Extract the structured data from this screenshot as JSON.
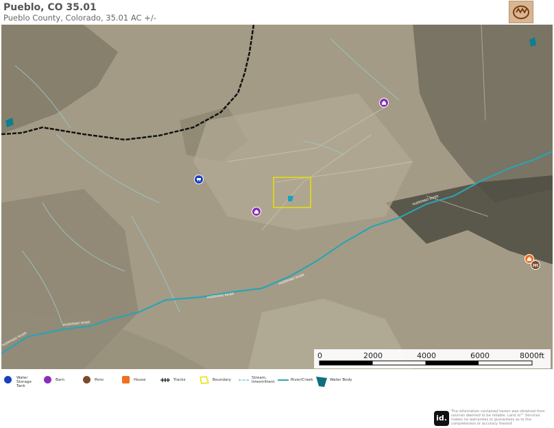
{
  "header": {
    "title": "Pueblo, CO 35.01",
    "subtitle": "Pueblo County, Colorado, 35.01 AC +/-"
  },
  "map": {
    "river_labels": [
      "HUERFANO RIVER",
      "HUERFANO RIVER",
      "HUERFANO RIVER",
      "HUERFANO RIVER",
      "HUERFANO RIVER"
    ],
    "colors": {
      "terrain": "#a39b86",
      "river": "#2aa3b4",
      "boundary": "#e8e000",
      "road": "#111111",
      "stream": "#9cc7c9"
    },
    "pois": [
      {
        "type": "Barn",
        "icon": "barn-icon",
        "color": "#8a2fb8"
      },
      {
        "type": "Barn",
        "icon": "barn-icon",
        "color": "#8a2fb8"
      },
      {
        "type": "Water Storage Tank",
        "icon": "water-tank-icon",
        "color": "#1a3fbd"
      },
      {
        "type": "House",
        "icon": "house-icon",
        "color": "#f07020"
      },
      {
        "type": "Pens",
        "icon": "pens-icon",
        "color": "#7a4a2a"
      }
    ]
  },
  "scale": {
    "ticks": [
      "0",
      "2000",
      "4000",
      "6000",
      "8000ft"
    ]
  },
  "legend": {
    "items": [
      {
        "label": "Water Storage Tank",
        "icon": "water-tank-icon",
        "color": "#1a3fbd"
      },
      {
        "label": "Barn",
        "icon": "barn-icon",
        "color": "#8a2fb8"
      },
      {
        "label": "Pens",
        "icon": "pens-icon",
        "color": "#7a4a2a"
      },
      {
        "label": "House",
        "icon": "house-icon",
        "color": "#f07020"
      },
      {
        "label": "Tracks",
        "icon": "tracks-icon",
        "color": "#111111"
      },
      {
        "label": "Boundary",
        "icon": "boundary-icon",
        "color": "#e8e000"
      },
      {
        "label": "Stream, Intermittent",
        "icon": "stream-icon",
        "color": "#2aa3b4"
      },
      {
        "label": "River/Creek",
        "icon": "river-icon",
        "color": "#2aa3b4"
      },
      {
        "label": "Water Body",
        "icon": "water-body-icon",
        "color": "#0e6f7e"
      }
    ]
  },
  "footer": {
    "disclaimer": "The information contained herein was obtained from sources deemed to be reliable. Land id™ Services makes no warranties or guarantees as to the completeness or accuracy thereof.",
    "logo_text": "id."
  }
}
